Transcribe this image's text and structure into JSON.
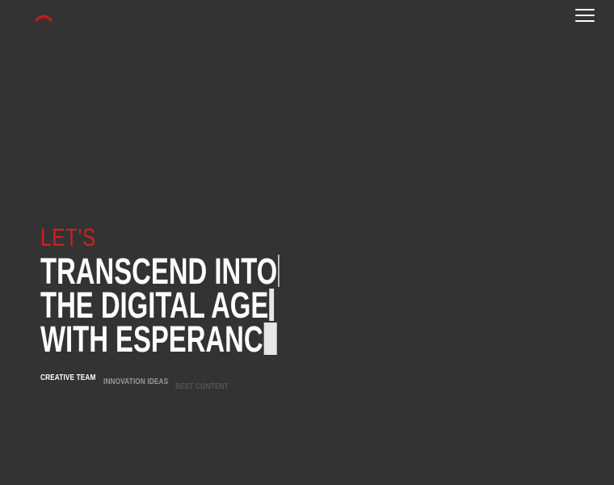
{
  "header": {
    "logo_icon": "red-arc-logo-icon",
    "menu_icon": "hamburger-menu-icon",
    "accent_color": "#d11f1f"
  },
  "hero": {
    "lead": "LET'S",
    "lines": [
      "TRANSCEND INTO",
      "THE DIGITAL AGE",
      "WITH ESPERANC"
    ]
  },
  "features": [
    "CREATIVE TEAM",
    "INNOVATION IDEAS",
    "BEST CONTENT"
  ],
  "colors": {
    "background": "#333333",
    "heading": "#ffffff",
    "accent": "#d11f1f"
  }
}
